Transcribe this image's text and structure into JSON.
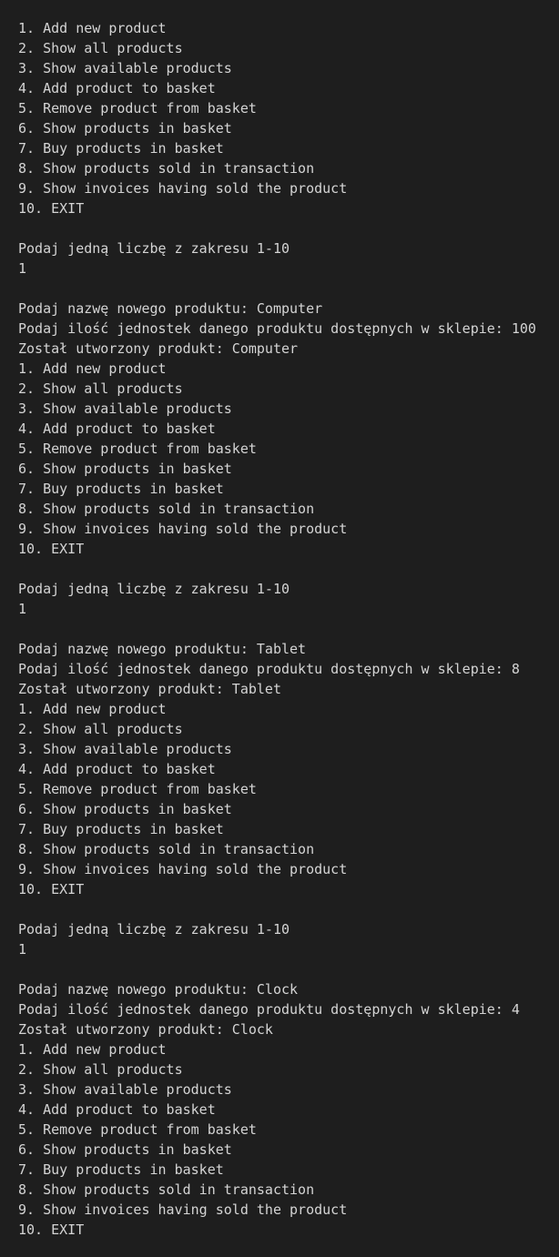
{
  "terminal": {
    "lines": [
      "1. Add new product",
      "2. Show all products",
      "3. Show available products",
      "4. Add product to basket",
      "5. Remove product from basket",
      "6. Show products in basket",
      "7. Buy products in basket",
      "8. Show products sold in transaction",
      "9. Show invoices having sold the product",
      "10. EXIT",
      "",
      "Podaj jedną liczbę z zakresu 1-10",
      "1",
      "",
      "Podaj nazwę nowego produktu: Computer",
      "Podaj ilość jednostek danego produktu dostępnych w sklepie: 100",
      "Został utworzony produkt: Computer",
      "1. Add new product",
      "2. Show all products",
      "3. Show available products",
      "4. Add product to basket",
      "5. Remove product from basket",
      "6. Show products in basket",
      "7. Buy products in basket",
      "8. Show products sold in transaction",
      "9. Show invoices having sold the product",
      "10. EXIT",
      "",
      "Podaj jedną liczbę z zakresu 1-10",
      "1",
      "",
      "Podaj nazwę nowego produktu: Tablet",
      "Podaj ilość jednostek danego produktu dostępnych w sklepie: 8",
      "Został utworzony produkt: Tablet",
      "1. Add new product",
      "2. Show all products",
      "3. Show available products",
      "4. Add product to basket",
      "5. Remove product from basket",
      "6. Show products in basket",
      "7. Buy products in basket",
      "8. Show products sold in transaction",
      "9. Show invoices having sold the product",
      "10. EXIT",
      "",
      "Podaj jedną liczbę z zakresu 1-10",
      "1",
      "",
      "Podaj nazwę nowego produktu: Clock",
      "Podaj ilość jednostek danego produktu dostępnych w sklepie: 4",
      "Został utworzony produkt: Clock",
      "1. Add new product",
      "2. Show all products",
      "3. Show available products",
      "4. Add product to basket",
      "5. Remove product from basket",
      "6. Show products in basket",
      "7. Buy products in basket",
      "8. Show products sold in transaction",
      "9. Show invoices having sold the product",
      "10. EXIT"
    ]
  }
}
